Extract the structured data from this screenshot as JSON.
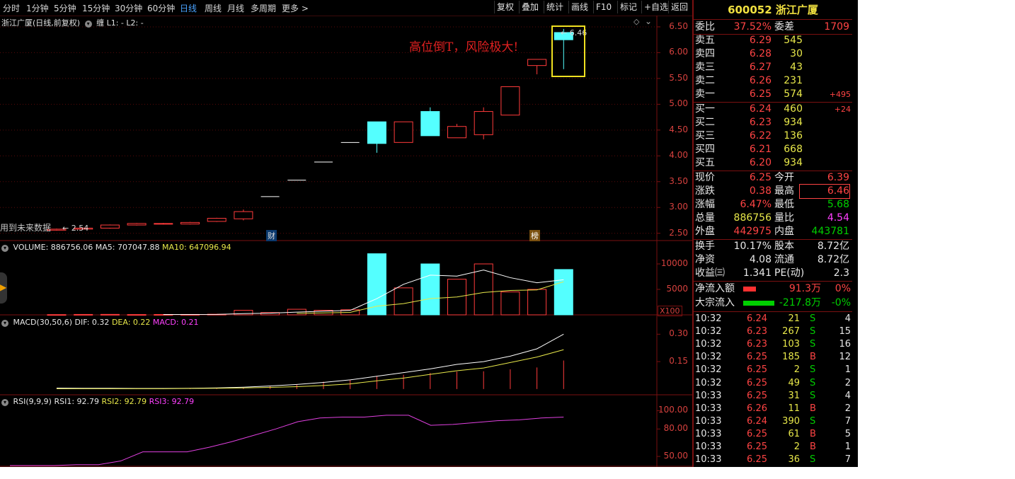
{
  "topbar": {
    "periods": [
      "分时",
      "1分钟",
      "5分钟",
      "15分钟",
      "30分钟",
      "60分钟",
      "日线",
      "周线",
      "月线",
      "多周期",
      "更多 >"
    ],
    "active_period": "日线",
    "buttons": [
      "复权",
      "叠加",
      "统计",
      "画线",
      "F10",
      "标记",
      "+自选",
      "返回"
    ]
  },
  "main_chart": {
    "title": "浙江广厦(日线,前复权)",
    "indicator": "缠",
    "l_labels": "L1: -  L2: -",
    "annotation": "高位倒T，风险极大!",
    "note_left": "用到未来数据",
    "low_marker": "2.54",
    "high_marker": "6.46",
    "badge_cai": "财",
    "badge_bang": "榜",
    "y_ticks": [
      "6.50",
      "6.00",
      "5.50",
      "5.00",
      "4.50",
      "4.00",
      "3.50",
      "3.00",
      "2.50"
    ]
  },
  "volume_panel": {
    "label": "VOLUME: 886756.06",
    "ma5": "MA5: 707047.88",
    "ma10": "MA10: 647096.94",
    "y_ticks": [
      "10000",
      "5000"
    ],
    "unit": "X100"
  },
  "macd_panel": {
    "label": "MACD(30,50,6)",
    "dif": "DIF: 0.32",
    "dea": "DEA: 0.22",
    "macd": "MACD: 0.21",
    "y_ticks": [
      "0.30",
      "0.15"
    ]
  },
  "rsi_panel": {
    "label": "RSI(9,9,9)",
    "rsi1": "RSI1: 92.79",
    "rsi2": "RSI2: 92.79",
    "rsi3": "RSI3: 92.79",
    "y_ticks": [
      "100.00",
      "80.00",
      "50.00"
    ]
  },
  "quote": {
    "header": "600052 浙江广厦",
    "weibi_label": "委比",
    "weibi": "37.52%",
    "weicha_label": "委差",
    "weicha": "1709",
    "asks": [
      {
        "label": "卖五",
        "price": "6.29",
        "vol": "545",
        "chg": ""
      },
      {
        "label": "卖四",
        "price": "6.28",
        "vol": "30",
        "chg": ""
      },
      {
        "label": "卖三",
        "price": "6.27",
        "vol": "43",
        "chg": ""
      },
      {
        "label": "卖二",
        "price": "6.26",
        "vol": "231",
        "chg": ""
      },
      {
        "label": "卖一",
        "price": "6.25",
        "vol": "574",
        "chg": "+495"
      }
    ],
    "bids": [
      {
        "label": "买一",
        "price": "6.24",
        "vol": "460",
        "chg": "+24"
      },
      {
        "label": "买二",
        "price": "6.23",
        "vol": "934",
        "chg": ""
      },
      {
        "label": "买三",
        "price": "6.22",
        "vol": "136",
        "chg": ""
      },
      {
        "label": "买四",
        "price": "6.21",
        "vol": "668",
        "chg": ""
      },
      {
        "label": "买五",
        "price": "6.20",
        "vol": "934",
        "chg": ""
      }
    ],
    "stats": [
      {
        "l1": "现价",
        "v1": "6.25",
        "l2": "今开",
        "v2": "6.39"
      },
      {
        "l1": "涨跌",
        "v1": "0.38",
        "l2": "最高",
        "v2": "6.46"
      },
      {
        "l1": "涨幅",
        "v1": "6.47%",
        "l2": "最低",
        "v2": "5.68"
      },
      {
        "l1": "总量",
        "v1": "886756",
        "l2": "量比",
        "v2": "4.54"
      },
      {
        "l1": "外盘",
        "v1": "442975",
        "l2": "内盘",
        "v2": "443781"
      }
    ],
    "stats2": [
      {
        "l1": "换手",
        "v1": "10.17%",
        "l2": "股本",
        "v2": "8.72亿"
      },
      {
        "l1": "净资",
        "v1": "4.08",
        "l2": "流通",
        "v2": "8.72亿"
      },
      {
        "l1": "收益㈢",
        "v1": "1.341",
        "l2": "PE(动)",
        "v2": "2.3"
      }
    ],
    "flows": [
      {
        "label": "净流入额",
        "value": "91.3万",
        "pct": "0%"
      },
      {
        "label": "大宗流入",
        "value": "-217.8万",
        "pct": "-0%"
      }
    ],
    "ticks": [
      {
        "t": "10:32",
        "p": "6.24",
        "v": "21",
        "s": "S",
        "n": "4"
      },
      {
        "t": "10:32",
        "p": "6.23",
        "v": "267",
        "s": "S",
        "n": "15"
      },
      {
        "t": "10:32",
        "p": "6.23",
        "v": "103",
        "s": "S",
        "n": "16"
      },
      {
        "t": "10:32",
        "p": "6.25",
        "v": "185",
        "s": "B",
        "n": "12"
      },
      {
        "t": "10:32",
        "p": "6.25",
        "v": "2",
        "s": "S",
        "n": "1"
      },
      {
        "t": "10:32",
        "p": "6.25",
        "v": "49",
        "s": "S",
        "n": "2"
      },
      {
        "t": "10:33",
        "p": "6.25",
        "v": "31",
        "s": "S",
        "n": "4"
      },
      {
        "t": "10:33",
        "p": "6.26",
        "v": "11",
        "s": "B",
        "n": "2"
      },
      {
        "t": "10:33",
        "p": "6.24",
        "v": "390",
        "s": "S",
        "n": "7"
      },
      {
        "t": "10:33",
        "p": "6.25",
        "v": "61",
        "s": "B",
        "n": "5"
      },
      {
        "t": "10:33",
        "p": "6.25",
        "v": "2",
        "s": "B",
        "n": "1"
      },
      {
        "t": "10:33",
        "p": "6.25",
        "v": "36",
        "s": "S",
        "n": "7"
      }
    ]
  },
  "chart_data": {
    "type": "candlestick",
    "y_range": [
      2.4,
      6.65
    ],
    "candles": [
      {
        "o": 2.56,
        "c": 2.58,
        "h": 2.59,
        "l": 2.55
      },
      {
        "o": 2.58,
        "c": 2.6,
        "h": 2.61,
        "l": 2.57
      },
      {
        "o": 2.6,
        "c": 2.66,
        "h": 2.67,
        "l": 2.59
      },
      {
        "o": 2.66,
        "c": 2.69,
        "h": 2.7,
        "l": 2.65
      },
      {
        "o": 2.68,
        "c": 2.69,
        "h": 2.7,
        "l": 2.67
      },
      {
        "o": 2.68,
        "c": 2.71,
        "h": 2.72,
        "l": 2.67
      },
      {
        "o": 2.73,
        "c": 2.79,
        "h": 2.8,
        "l": 2.72
      },
      {
        "o": 2.78,
        "c": 2.92,
        "h": 2.96,
        "l": 2.75
      },
      {
        "o": 3.21,
        "c": 3.21,
        "h": 3.21,
        "l": 3.21
      },
      {
        "o": 3.53,
        "c": 3.53,
        "h": 3.53,
        "l": 3.53
      },
      {
        "o": 3.88,
        "c": 3.88,
        "h": 3.88,
        "l": 3.88
      },
      {
        "o": 4.26,
        "c": 4.26,
        "h": 4.26,
        "l": 4.26
      },
      {
        "o": 4.66,
        "c": 4.24,
        "h": 4.66,
        "l": 4.06
      },
      {
        "o": 4.26,
        "c": 4.66,
        "h": 4.66,
        "l": 4.26
      },
      {
        "o": 4.86,
        "c": 4.39,
        "h": 4.94,
        "l": 4.39
      },
      {
        "o": 4.35,
        "c": 4.57,
        "h": 4.62,
        "l": 4.35
      },
      {
        "o": 4.41,
        "c": 4.86,
        "h": 4.94,
        "l": 4.32
      },
      {
        "o": 4.79,
        "c": 5.34,
        "h": 5.34,
        "l": 4.79
      },
      {
        "o": 5.75,
        "c": 5.87,
        "h": 5.87,
        "l": 5.58
      },
      {
        "o": 6.39,
        "c": 6.25,
        "h": 6.46,
        "l": 5.68
      }
    ],
    "volume": [
      50,
      80,
      90,
      60,
      70,
      80,
      120,
      900,
      450,
      1100,
      900,
      1000,
      12000,
      5300,
      10000,
      7000,
      10000,
      4500,
      5000,
      8900
    ],
    "volume_range": [
      0,
      12500
    ],
    "ma5": [
      null,
      null,
      null,
      null,
      70,
      76,
      88,
      246,
      324,
      530,
      704,
      878,
      3180,
      6000,
      7800,
      7600,
      8800,
      7300,
      6300,
      6900
    ],
    "ma10": [
      null,
      null,
      null,
      null,
      null,
      null,
      null,
      null,
      null,
      292,
      380,
      492,
      1700,
      2200,
      3200,
      3500,
      4400,
      4800,
      4900,
      6500
    ],
    "macd": {
      "range": [
        -0.02,
        0.34
      ],
      "dif": [
        0.005,
        0.004,
        0.004,
        0.003,
        0.003,
        0.004,
        0.006,
        0.01,
        0.017,
        0.025,
        0.036,
        0.05,
        0.07,
        0.09,
        0.11,
        0.135,
        0.15,
        0.18,
        0.22,
        0.3
      ],
      "dea": [
        0.002,
        0.002,
        0.002,
        0.002,
        0.002,
        0.003,
        0.004,
        0.006,
        0.009,
        0.013,
        0.019,
        0.028,
        0.045,
        0.06,
        0.08,
        0.1,
        0.115,
        0.145,
        0.175,
        0.215
      ],
      "hist": [
        0.001,
        0.001,
        0.001,
        0.001,
        0.001,
        0.002,
        0.003,
        0.008,
        0.016,
        0.026,
        0.04,
        0.05,
        0.072,
        0.078,
        0.088,
        0.095,
        0.097,
        0.108,
        0.118,
        0.156
      ]
    },
    "rsi": {
      "range": [
        40,
        105
      ],
      "rsi1": [
        40,
        40,
        40,
        41,
        41,
        45,
        55,
        55,
        55,
        60,
        66,
        73,
        80,
        88,
        92,
        93,
        93,
        95,
        95,
        84,
        85,
        87,
        89,
        90,
        92,
        93
      ]
    }
  }
}
